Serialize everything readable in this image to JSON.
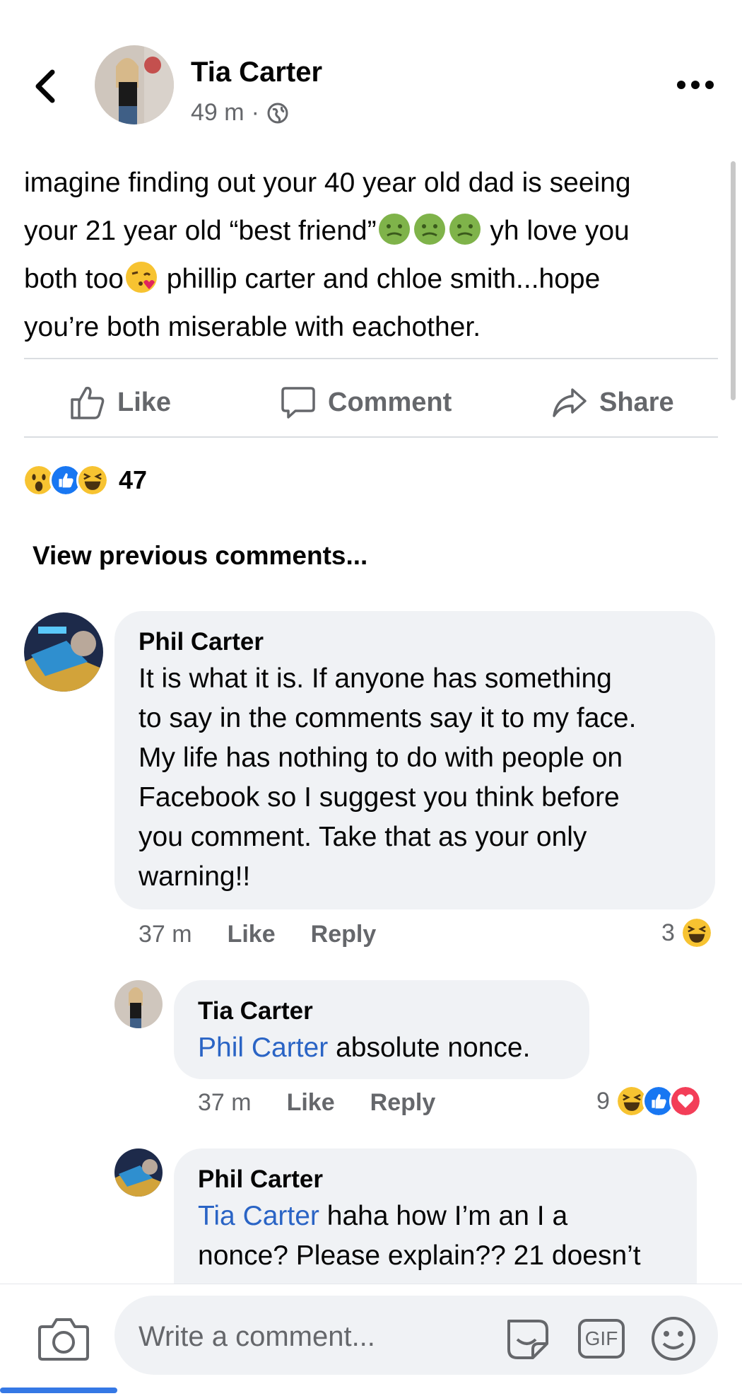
{
  "header": {
    "back_icon": "chevron-left-icon",
    "author": "Tia Carter",
    "time": "49 m",
    "separator": "·",
    "privacy_icon": "globe-icon",
    "more_icon": "ellipsis-icon"
  },
  "post": {
    "line1": "imagine finding out your 40 year old dad is seeing",
    "line2a": "your 21 year old “best friend”",
    "line2b": " yh love you",
    "line3a": "both too",
    "line3b": " phillip carter and chloe smith...hope",
    "line4": "you’re both miserable with eachother."
  },
  "actions": {
    "like": "Like",
    "comment": "Comment",
    "share": "Share"
  },
  "reactions": {
    "count": "47",
    "icons": [
      "wow-icon",
      "like-icon",
      "haha-icon"
    ]
  },
  "view_previous": "View previous comments...",
  "comments": [
    {
      "name": "Phil Carter",
      "lines": [
        "It is what it is. If anyone has something",
        "to say in the comments say it to my face.",
        "My life has nothing to do with people on",
        "Facebook so I suggest you think before",
        "you comment. Take that as your only",
        "warning!!"
      ],
      "time": "37 m",
      "like": "Like",
      "reply": "Reply",
      "reaction_count": "3"
    },
    {
      "name": "Tia Carter",
      "mention": "Phil Carter",
      "text": " absolute nonce.",
      "time": "37 m",
      "like": "Like",
      "reply": "Reply",
      "reaction_count": "9"
    },
    {
      "name": "Phil Carter",
      "mention": "Tia Carter",
      "text1": " haha how I’m an I a",
      "text2": "nonce? Please explain?? 21 doesn’t"
    }
  ],
  "composer": {
    "placeholder": "Write a comment...",
    "gif_label": "GIF"
  },
  "colors": {
    "link": "#2a64c5",
    "muted": "#65676b",
    "bubble": "#f0f2f5",
    "like_blue": "#1877f2"
  }
}
